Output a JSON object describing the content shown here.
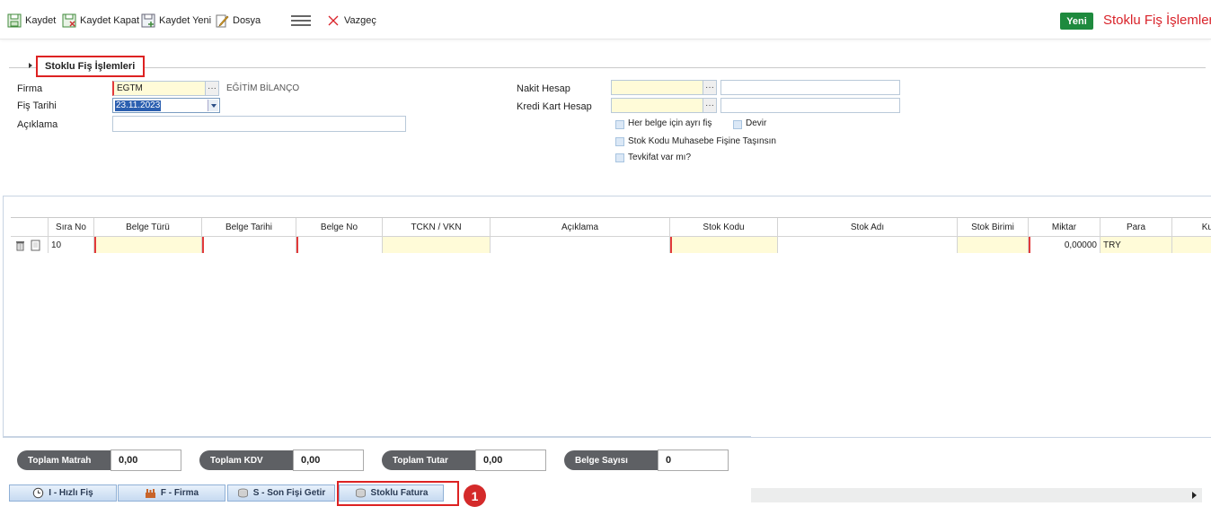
{
  "toolbar": {
    "save": "Kaydet",
    "save_close": "Kaydet Kapat",
    "save_new": "Kaydet Yeni",
    "file": "Dosya",
    "cancel": "Vazgeç",
    "new": "Yeni",
    "page_title": "Stoklu Fiş İşlemleri"
  },
  "section": {
    "title": "Stoklu Fiş İşlemleri"
  },
  "form": {
    "firma_label": "Firma",
    "firma_code": "EGTM",
    "firma_name": "EĞİTİM BİLANÇO",
    "fis_tarihi_label": "Fiş Tarihi",
    "fis_tarihi": "23.11.2023",
    "aciklama_label": "Açıklama",
    "aciklama": "",
    "nakit_hesap_label": "Nakit Hesap",
    "kredi_kart_label": "Kredi Kart Hesap",
    "ellipsis": "···",
    "cb_her_belge": "Her belge için ayrı fiş",
    "cb_devir": "Devir",
    "cb_stok_kodu": "Stok Kodu Muhasebe Fişine Taşınsın",
    "cb_tevkifat": "Tevkifat var mı?"
  },
  "grid": {
    "columns": [
      "Sıra No",
      "Belge Türü",
      "Belge Tarihi",
      "Belge No",
      "TCKN / VKN",
      "Açıklama",
      "Stok Kodu",
      "Stok Adı",
      "Stok Birimi",
      "Miktar",
      "Para",
      "Ku"
    ],
    "row": {
      "sira_no": "10",
      "belge_turu": "",
      "belge_tarihi": "",
      "belge_no": "",
      "tckn": "",
      "aciklama": "",
      "stok_kodu": "",
      "stok_adi": "",
      "stok_birimi": "",
      "miktar": "0,00000",
      "para": "TRY"
    }
  },
  "totals": {
    "matrah_label": "Toplam Matrah",
    "matrah": "0,00",
    "kdv_label": "Toplam KDV",
    "kdv": "0,00",
    "tutar_label": "Toplam Tutar",
    "tutar": "0,00",
    "belge_label": "Belge Sayısı",
    "belge": "0"
  },
  "buttons": {
    "hizli_fis": "I - Hızlı Fiş",
    "firma": "F - Firma",
    "son_fis": "S - Son Fişi Getir",
    "stoklu_fatura": "Stoklu Fatura"
  },
  "annotation": {
    "badge": "1"
  },
  "colors": {
    "accent_red": "#d9232a",
    "new_green": "#1e8a3e",
    "required_yellow": "#fffbd8"
  }
}
